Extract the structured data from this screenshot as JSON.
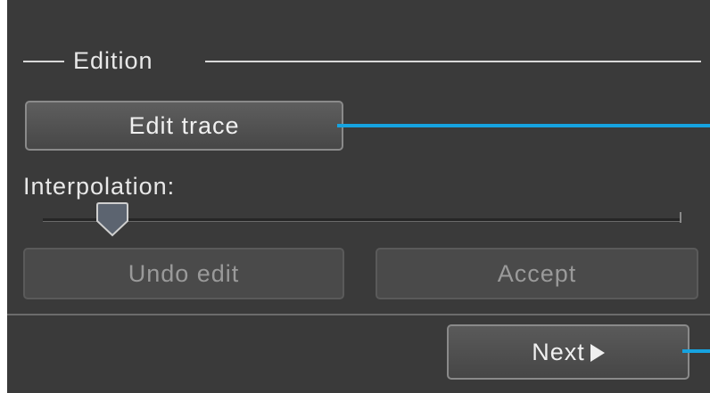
{
  "edition_group": {
    "title": "Edition"
  },
  "buttons": {
    "edit_trace_label": "Edit trace",
    "undo_edit_label": "Undo edit",
    "accept_label": "Accept",
    "next_label": "Next"
  },
  "interpolation": {
    "label": "Interpolation:",
    "value_fraction": 0.1
  },
  "icons": {
    "next": "play-arrow-icon"
  },
  "colors": {
    "panel_bg": "#3a3a3a",
    "callout": "#16a3e0",
    "disabled_text": "#9a9a9a"
  }
}
